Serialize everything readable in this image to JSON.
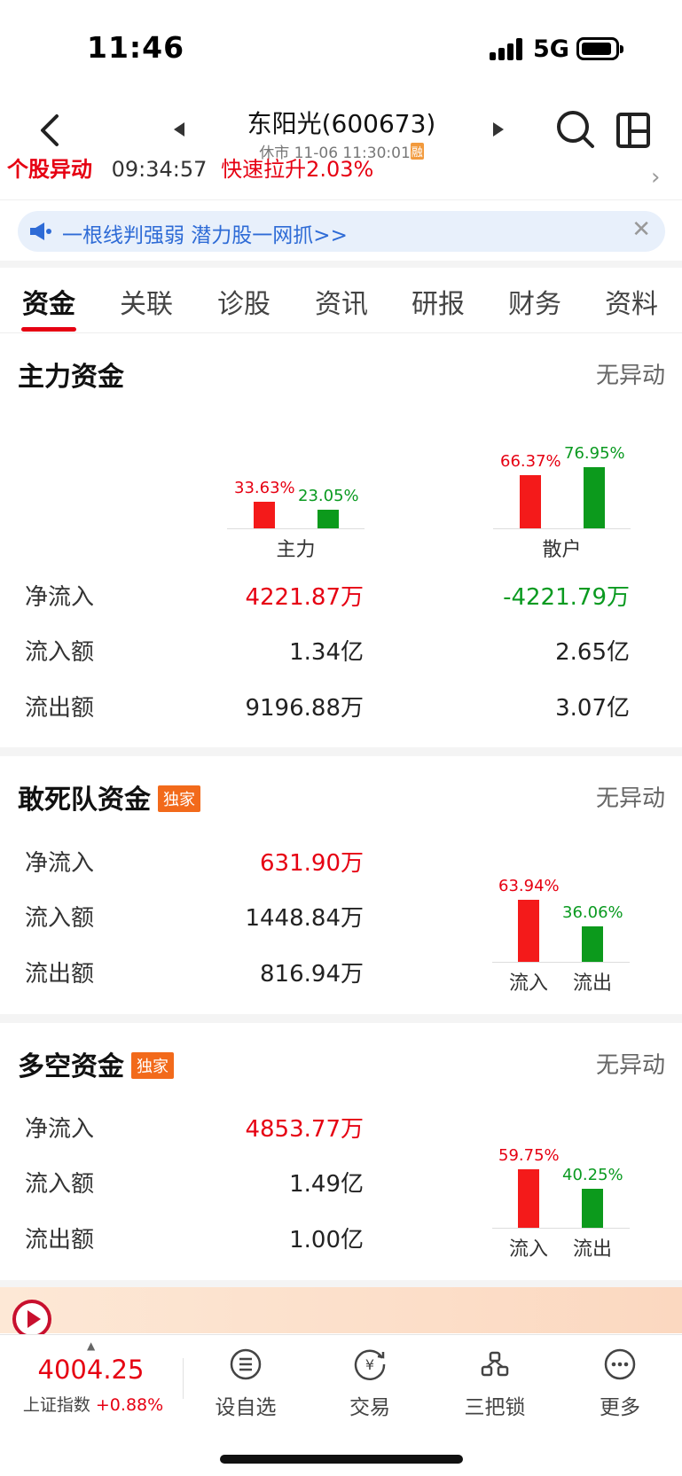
{
  "status_bar": {
    "time": "11:46",
    "network": "5G"
  },
  "header": {
    "stock_title": "东阳光(600673)",
    "market_status": "休市 11-06 11:30:01",
    "margin_tag": "融"
  },
  "ticker": {
    "tag": "个股异动",
    "time": "09:34:57",
    "message": "快速拉升2.03%"
  },
  "banner": {
    "text": "一根线判强弱 潜力股一网抓>>",
    "close": "✕"
  },
  "tabs": [
    "资金",
    "关联",
    "诊股",
    "资讯",
    "研报",
    "财务",
    "资料"
  ],
  "main_funds": {
    "title": "主力资金",
    "status": "无异动",
    "chart_data": {
      "type": "bar",
      "categories": [
        "主力",
        "散户"
      ],
      "series": [
        {
          "name": "流入",
          "values": [
            33.63,
            66.37
          ],
          "color": "#f41a1a"
        },
        {
          "name": "流出",
          "values": [
            23.05,
            76.95
          ],
          "color": "#0c9a1c"
        }
      ],
      "labels": [
        [
          "33.63%",
          "23.05%"
        ],
        [
          "66.37%",
          "76.95%"
        ]
      ],
      "ylim": [
        0,
        100
      ]
    },
    "rows": [
      {
        "label": "净流入",
        "main": "4221.87万",
        "retail": "-4221.79万"
      },
      {
        "label": "流入额",
        "main": "1.34亿",
        "retail": "2.65亿"
      },
      {
        "label": "流出额",
        "main": "9196.88万",
        "retail": "3.07亿"
      }
    ]
  },
  "dare_funds": {
    "title": "敢死队资金",
    "badge": "独家",
    "status": "无异动",
    "rows": [
      {
        "label": "净流入",
        "value": "631.90万"
      },
      {
        "label": "流入额",
        "value": "1448.84万"
      },
      {
        "label": "流出额",
        "value": "816.94万"
      }
    ],
    "chart_data": {
      "type": "bar",
      "categories": [
        "流入",
        "流出"
      ],
      "values": [
        63.94,
        36.06
      ],
      "labels": [
        "63.94%",
        "36.06%"
      ],
      "ylim": [
        0,
        100
      ]
    }
  },
  "long_short_funds": {
    "title": "多空资金",
    "badge": "独家",
    "status": "无异动",
    "rows": [
      {
        "label": "净流入",
        "value": "4853.77万"
      },
      {
        "label": "流入额",
        "value": "1.49亿"
      },
      {
        "label": "流出额",
        "value": "1.00亿"
      }
    ],
    "chart_data": {
      "type": "bar",
      "categories": [
        "流入",
        "流出"
      ],
      "values": [
        59.75,
        40.25
      ],
      "labels": [
        "59.75%",
        "40.25%"
      ],
      "ylim": [
        0,
        100
      ]
    }
  },
  "bottom_bar": {
    "index_value": "4004.25",
    "index_name": "上证指数",
    "index_change": "+0.88%",
    "nav": [
      "设自选",
      "交易",
      "三把锁",
      "更多"
    ]
  },
  "colors": {
    "up": "#e60012",
    "down": "#0a9a20",
    "accent": "#2e6bd6"
  }
}
